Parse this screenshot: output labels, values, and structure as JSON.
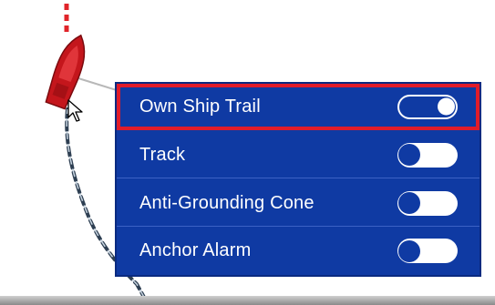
{
  "menu": {
    "items": [
      {
        "label": "Own Ship Trail",
        "toggle_on": true,
        "selected": true
      },
      {
        "label": "Track",
        "toggle_on": false,
        "selected": false
      },
      {
        "label": "Anti-Grounding Cone",
        "toggle_on": false,
        "selected": false
      },
      {
        "label": "Anchor Alarm",
        "toggle_on": false,
        "selected": false
      }
    ]
  },
  "colors": {
    "menu_bg": "#0f3aa3",
    "highlight": "#e01c2a",
    "ship": "#c4161c",
    "heading_line": "#e0242a",
    "trail": "#2e3f52"
  }
}
